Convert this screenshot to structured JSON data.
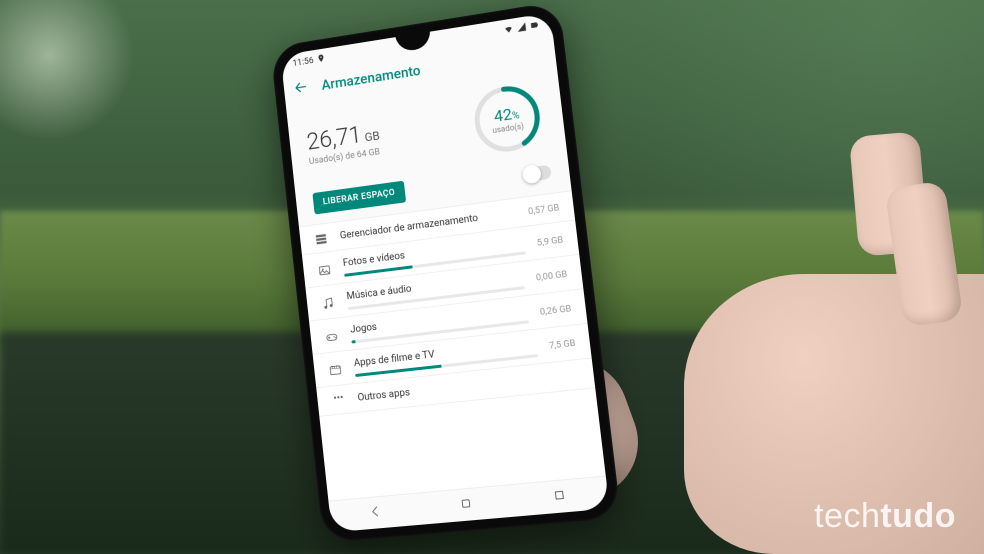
{
  "watermark": {
    "prefix": "tech",
    "suffix": "tudo"
  },
  "status": {
    "time": "11:56"
  },
  "header": {
    "title": "Armazenamento"
  },
  "summary": {
    "used_value": "26,71",
    "used_unit": "GB",
    "used_of": "Usado(s) de 64 GB",
    "percent": "42",
    "percent_symbol": "%",
    "percent_label": "usado(s)"
  },
  "actions": {
    "free_space": "LIBERAR ESPAÇO"
  },
  "rows": [
    {
      "label": "Gerenciador de armazenamento",
      "size": "0,57 GB",
      "fill": 4
    },
    {
      "label": "Fotos e vídeos",
      "size": "5,9 GB",
      "fill": 38
    },
    {
      "label": "Música e áudio",
      "size": "0,00 GB",
      "fill": 0
    },
    {
      "label": "Jogos",
      "size": "0,26 GB",
      "fill": 2
    },
    {
      "label": "Apps de filme e TV",
      "size": "7,5 GB",
      "fill": 48
    },
    {
      "label": "Outros apps",
      "size": "",
      "fill": 0
    }
  ]
}
